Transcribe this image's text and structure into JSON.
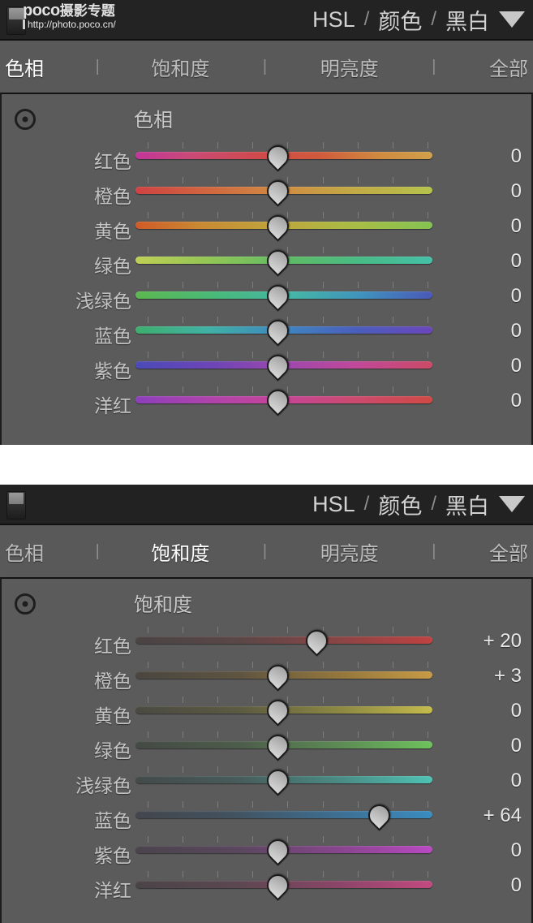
{
  "watermark": {
    "brand": "poco",
    "brand_cn": "摄影专题",
    "url": "http://photo.poco.cn/"
  },
  "header": {
    "title_parts": [
      "HSL",
      "颜色",
      "黑白"
    ],
    "separator": "/",
    "caret_icon": "chevron-down-icon",
    "toggle_icon": "panel-switch-icon"
  },
  "tabs": {
    "separator": "|",
    "items": [
      "色相",
      "饱和度",
      "明亮度",
      "全部"
    ]
  },
  "panels": [
    {
      "id": "hue-panel",
      "active_tab": "色相",
      "section_label": "色相",
      "target_icon": "target-adjust-icon",
      "rows": [
        {
          "label": "红色",
          "value": "0",
          "pos": 48,
          "gradient": "linear-gradient(90deg, #c3359a 0%, #c94a78 18%, #cf4a4a 42%, #d05a3c 62%, #d08a3f 82%, #d0a04a 100%)"
        },
        {
          "label": "橙色",
          "value": "0",
          "pos": 48,
          "gradient": "linear-gradient(90deg, #cf4242 0%, #d06340 22%, #d18a42 48%, #c3a845 72%, #b5c24c 100%)"
        },
        {
          "label": "黄色",
          "value": "0",
          "pos": 48,
          "gradient": "linear-gradient(90deg, #d05a27 0%, #c98a33 22%, #bfa63c 48%, #a8bd45 74%, #84c352 100%)"
        },
        {
          "label": "绿色",
          "value": "0",
          "pos": 48,
          "gradient": "linear-gradient(90deg, #c0cf55 0%, #93c655 24%, #5ebb66 52%, #48bb86 76%, #46c0a8 100%)"
        },
        {
          "label": "浅绿色",
          "value": "0",
          "pos": 48,
          "gradient": "linear-gradient(90deg, #5cb84f 0%, #49b978 26%, #45b6a6 52%, #3f93bd 76%, #4a58b8 100%)"
        },
        {
          "label": "蓝色",
          "value": "0",
          "pos": 48,
          "gradient": "linear-gradient(90deg, #3fae6e 0%, #40b2a4 24%, #3f86c0 50%, #4a5ebc 74%, #6b46bb 100%)"
        },
        {
          "label": "紫色",
          "value": "0",
          "pos": 48,
          "gradient": "linear-gradient(90deg, #4b4ab8 0%, #6d45b7 26%, #a048ac 52%, #c0489a 74%, #cb4a66 100%)"
        },
        {
          "label": "洋红",
          "value": "0",
          "pos": 48,
          "gradient": "linear-gradient(90deg, #8d3fbc 0%, #ae43ab 24%, #c5459a 48%, #cb4a72 72%, #cf4a44 100%)"
        }
      ]
    },
    {
      "id": "saturation-panel",
      "active_tab": "饱和度",
      "section_label": "饱和度",
      "target_icon": "target-adjust-icon",
      "rows": [
        {
          "label": "红色",
          "value": "+ 20",
          "pos": 61,
          "gradient": "linear-gradient(90deg, #4a4444 0%, #5b4747 35%, #8a4545 68%, #c04242 100%)"
        },
        {
          "label": "橙色",
          "value": "+ 3",
          "pos": 48,
          "gradient": "linear-gradient(90deg, #4a4640 0%, #5e5440 35%, #96783c 70%, #c79b45 100%)"
        },
        {
          "label": "黄色",
          "value": "0",
          "pos": 48,
          "gradient": "linear-gradient(90deg, #4a4a42 0%, #5c5a42 35%, #8e8a42 70%, #c4bb4c 100%)"
        },
        {
          "label": "绿色",
          "value": "0",
          "pos": 48,
          "gradient": "linear-gradient(90deg, #444a44 0%, #4c5c4a 35%, #5d8d55 70%, #6ec25c 100%)"
        },
        {
          "label": "浅绿色",
          "value": "0",
          "pos": 48,
          "gradient": "linear-gradient(90deg, #444a4a 0%, #475c5b 35%, #4a8d86 70%, #4fc2b4 100%)"
        },
        {
          "label": "蓝色",
          "value": "+ 64",
          "pos": 82,
          "gradient": "linear-gradient(90deg, #43464d 0%, #42525f 32%, #3e6d8f 66%, #3a8cc0 100%)"
        },
        {
          "label": "紫色",
          "value": "0",
          "pos": 48,
          "gradient": "linear-gradient(90deg, #4a444c 0%, #5a475e 35%, #8a4590 70%, #b949c2 100%)"
        },
        {
          "label": "洋红",
          "value": "0",
          "pos": 48,
          "gradient": "linear-gradient(90deg, #4a4447 0%, #5c4750 35%, #8e4569 70%, #c24a80 100%)"
        }
      ]
    }
  ]
}
